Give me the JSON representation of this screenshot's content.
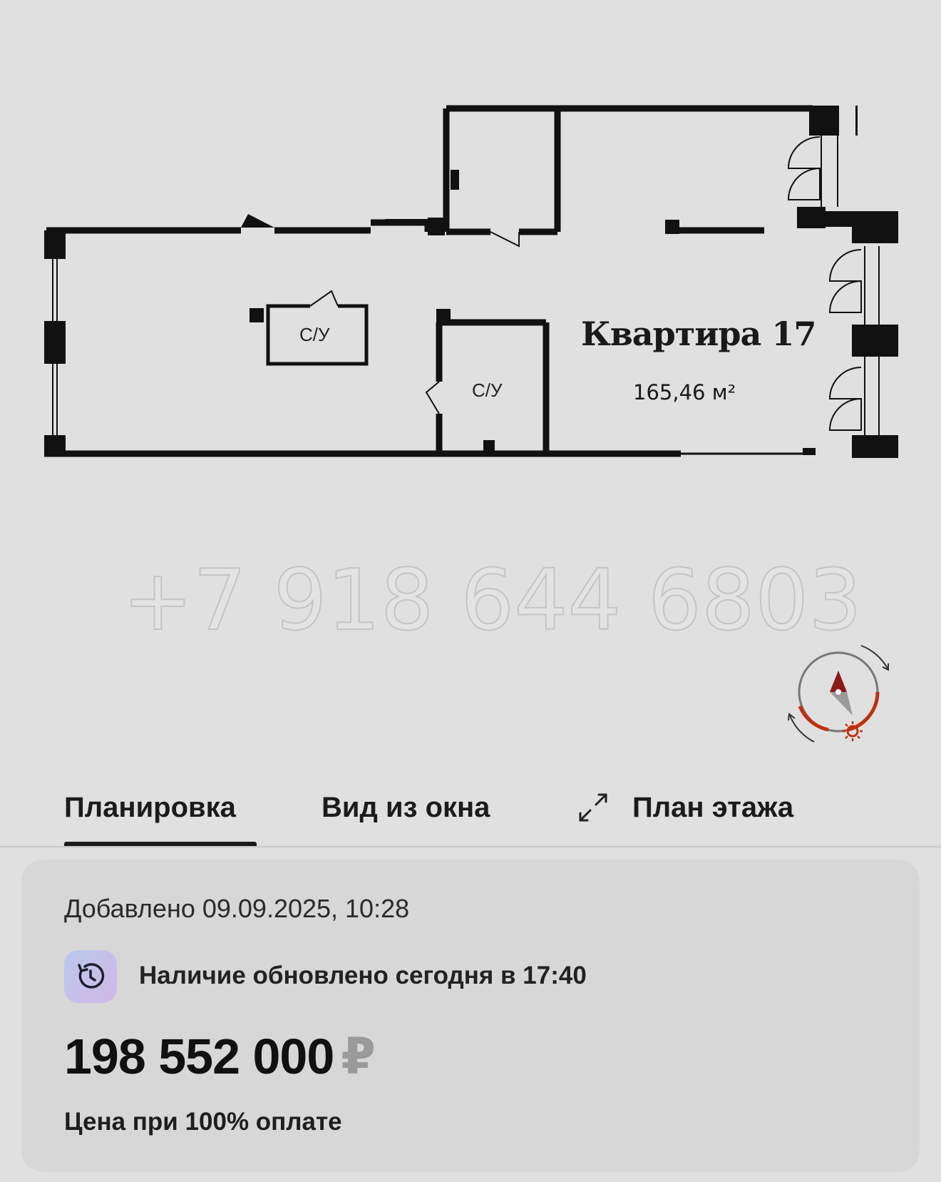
{
  "floorplan": {
    "apartment_title": "Квартира 17",
    "apartment_area": "165,46 м²",
    "room_labels": [
      "С/У",
      "С/У"
    ],
    "watermark_phone": "+7 918 644 6803",
    "compass": {
      "icon": "compass-icon",
      "sun_icon": "sun-icon",
      "rotate_icon": "rotate-arrows-icon"
    }
  },
  "tabs": {
    "active_index": 0,
    "items": [
      {
        "label": "Планировка"
      },
      {
        "label": "Вид из окна"
      },
      {
        "label": "План этажа",
        "icon": "expand-icon"
      }
    ]
  },
  "info": {
    "added": "Добавлено 09.09.2025, 10:28",
    "availability": "Наличие обновлено сегодня в 17:40",
    "availability_icon": "clock-refresh-icon",
    "price": "198 552 000",
    "currency": "₽",
    "price_note": "Цена при 100% оплате"
  },
  "colors": {
    "background": "#e0e0e0",
    "card": "#d7d7d7",
    "compass_arrow": "#8b1a1a",
    "compass_arc": "#c0300f",
    "badge_gradient": [
      "#b9c8ec",
      "#d2b8e6"
    ]
  }
}
